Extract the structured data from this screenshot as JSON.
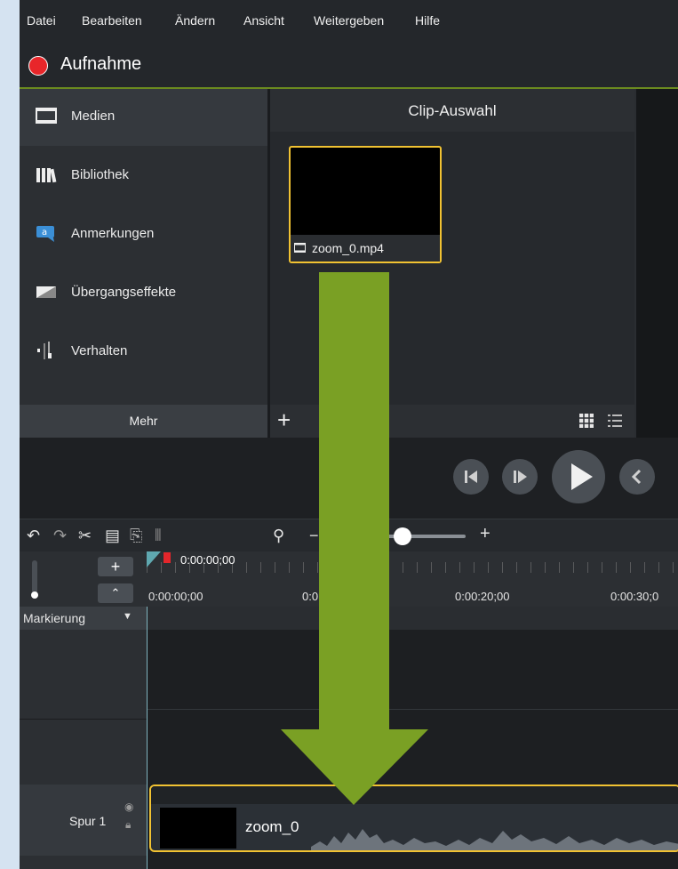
{
  "menu": [
    "Datei",
    "Bearbeiten",
    "Ändern",
    "Ansicht",
    "Weitergeben",
    "Hilfe"
  ],
  "record": {
    "label": "Aufnahme"
  },
  "sidebar": {
    "items": [
      {
        "label": "Medien",
        "icon": "film-strip-icon"
      },
      {
        "label": "Bibliothek",
        "icon": "library-books-icon"
      },
      {
        "label": "Anmerkungen",
        "icon": "callout-icon"
      },
      {
        "label": "Übergangseffekte",
        "icon": "transition-icon"
      },
      {
        "label": "Verhalten",
        "icon": "behavior-icon"
      }
    ],
    "more": "Mehr"
  },
  "clipbin": {
    "title": "Clip-Auswahl",
    "clip_name": "zoom_0.mp4",
    "add": "+"
  },
  "timeline": {
    "playhead_time": "0:00:00;00",
    "ruler_labels": [
      "0:00:00;00",
      "0:0",
      "0:00:20;00",
      "0:00:30;0"
    ],
    "marker_label": "Markierung",
    "track_label": "Spur 1",
    "clip_name": "zoom_0",
    "zoom_plus": "+",
    "zoom_minus": "−",
    "add_track": "+"
  },
  "colors": {
    "accent_green": "#7aa024",
    "clip_border": "#f1c232",
    "record_red": "#e8262a"
  }
}
